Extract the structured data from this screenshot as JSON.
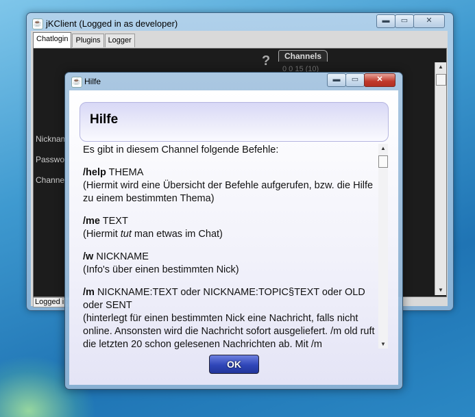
{
  "main_window": {
    "title": "jKClient (Logged in as developer)",
    "tabs": [
      "Chatlogin",
      "Plugins",
      "Logger"
    ],
    "side_labels": [
      "Nicknam",
      "Passwo",
      "Channe"
    ],
    "help_glyph": "?",
    "channels_tab": "Channels",
    "channel_partial": "0 0 15 (10)",
    "status": "Logged in"
  },
  "dialog": {
    "title": "Hilfe",
    "header": "Hilfe",
    "intro": "Es gibt in diesem Channel folgende Befehle:",
    "commands": [
      {
        "cmd": "/help",
        "arg": "THEMA",
        "desc": "(Hiermit wird eine Übersicht der Befehle aufgerufen, bzw. die Hilfe zu einem bestimmten Thema)"
      },
      {
        "cmd": "/me",
        "arg": "TEXT",
        "desc_before": "(Hiermit ",
        "desc_italic": "tut",
        "desc_after": " man etwas im Chat)"
      },
      {
        "cmd": "/w",
        "arg": "NICKNAME",
        "desc": "(Info's über einen bestimmten Nick)"
      },
      {
        "cmd": "/m",
        "arg": "NICKNAME:TEXT oder NICKNAME:TOPIC§TEXT oder OLD oder SENT",
        "desc": "(hinterlegt für einen bestimmten Nick eine Nachricht, falls nicht online. Ansonsten wird die Nachricht sofort ausgeliefert. /m old ruft die letzten 20 schon gelesenen Nachrichten ab. Mit /m"
      }
    ],
    "ok_label": "OK"
  },
  "icons": {
    "java": "java-cup-icon",
    "minimize": "minimize-icon",
    "maximize": "maximize-icon",
    "close": "close-icon"
  }
}
